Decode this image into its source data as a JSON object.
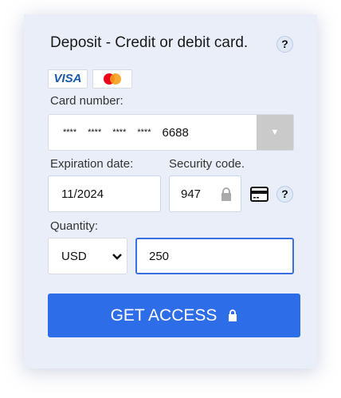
{
  "title": "Deposit - Credit or debit card.",
  "help": "?",
  "cards": {
    "visa": "VISA"
  },
  "card_number": {
    "label": "Card number:",
    "masked": [
      "****",
      "****",
      "****",
      "****"
    ],
    "last4": "6688"
  },
  "expiration": {
    "label": "Expiration date:",
    "value": "11/2024"
  },
  "security": {
    "label": "Security code.",
    "value": "947"
  },
  "quantity": {
    "label": "Quantity:",
    "currency": "USD",
    "amount": "250"
  },
  "submit": "GET ACCESS",
  "colors": {
    "accent": "#2e6de8",
    "background": "#e9eef8"
  }
}
